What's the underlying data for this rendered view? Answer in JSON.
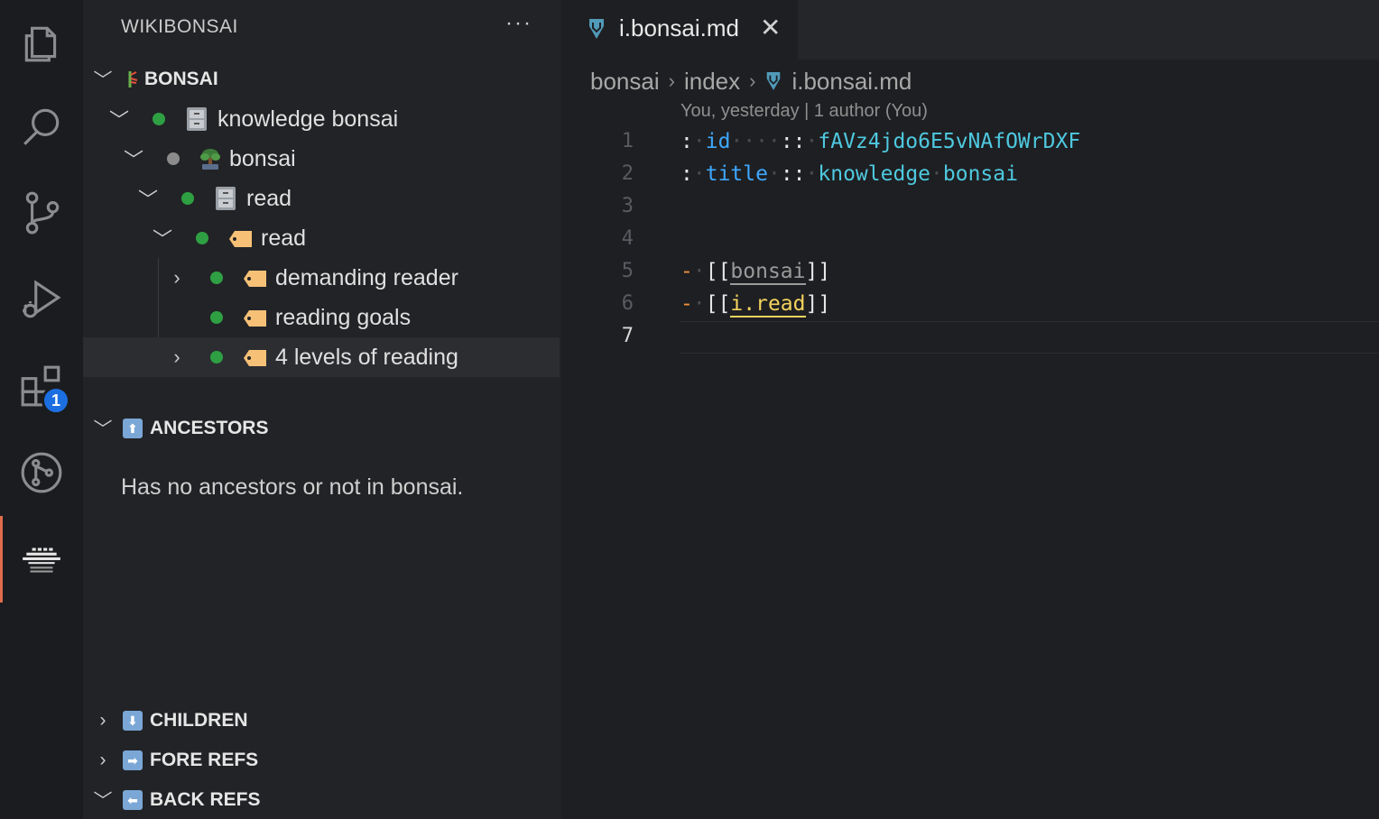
{
  "sidebar": {
    "title": "WIKIBONSAI",
    "more": "···",
    "bonsai_section": "BONSAI",
    "tree": [
      {
        "label": "knowledge bonsai",
        "chev": "﹀",
        "dot": "green",
        "icon": "file-cabinet-icon"
      },
      {
        "label": "bonsai",
        "chev": "﹀",
        "dot": "gray",
        "icon": "bonsai-tree-icon"
      },
      {
        "label": "read",
        "chev": "﹀",
        "dot": "green",
        "icon": "file-cabinet-icon"
      },
      {
        "label": "read",
        "chev": "﹀",
        "dot": "green",
        "icon": "label-tag-icon"
      },
      {
        "label": "demanding reader",
        "chev": "›",
        "dot": "green",
        "icon": "label-tag-icon"
      },
      {
        "label": "reading goals",
        "chev": "",
        "dot": "green",
        "icon": "label-tag-icon"
      },
      {
        "label": "4 levels of reading",
        "chev": "›",
        "dot": "green",
        "icon": "label-tag-icon"
      }
    ],
    "ancestors_section": "ANCESTORS",
    "ancestors_message": "Has no ancestors or not in bonsai.",
    "children_section": "CHILDREN",
    "fore_refs_section": "FORE REFS",
    "back_refs_section": "BACK REFS"
  },
  "activity": {
    "extensions_badge": "1"
  },
  "editor": {
    "tab_label": "i.bonsai.md",
    "tab_close": "✕",
    "breadcrumb": [
      "bonsai",
      "index",
      "i.bonsai.md"
    ],
    "blame": "You, yesterday | 1 author (You)",
    "line_numbers": [
      "1",
      "2",
      "3",
      "4",
      "5",
      "6",
      "7"
    ],
    "line1": {
      "colon": ":",
      "key": "id",
      "dots": "····",
      "sep": "::",
      "value": "fAVz4jdo6E5vNAfOWrDXF"
    },
    "line2": {
      "colon": ":",
      "key": "title",
      "dots": "·",
      "sep": "::",
      "value": "knowledge",
      "value2": "bonsai"
    },
    "line5": {
      "dash": "-",
      "open": "[[",
      "link": "bonsai",
      "close": "]]"
    },
    "line6": {
      "dash": "-",
      "open": "[[",
      "link": "i.read",
      "close": "]]"
    }
  },
  "colors": {
    "accent": "#e06c4b",
    "badge": "#1c6fe0",
    "green_dot": "#2ea043",
    "link_highlight": "#f4d35e"
  }
}
